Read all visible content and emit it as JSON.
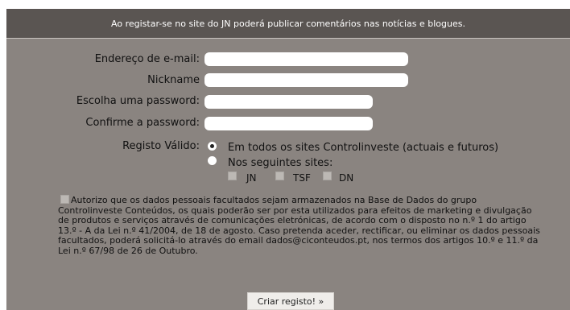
{
  "banner": {
    "text": "Ao registar-se no site do JN poderá publicar comentários nas notícias e blogues."
  },
  "form": {
    "email_label": "Endereço de e-mail:",
    "email_value": "",
    "nickname_label": "Nickname",
    "nickname_value": "",
    "password_label": "Escolha uma password:",
    "password_value": "",
    "confirm_label": "Confirme a password:",
    "confirm_value": "",
    "registo_label": "Registo Válido:",
    "option_all_label": "Em todos os sites Controlinveste (actuais e futuros)",
    "option_all_checked": true,
    "option_some_label": "Nos seguintes sites:",
    "option_some_checked": false,
    "sites": [
      {
        "label": "JN",
        "checked": false
      },
      {
        "label": "TSF",
        "checked": false
      },
      {
        "label": "DN",
        "checked": false
      }
    ],
    "consent_checked": false,
    "consent_text": "Autorizo que os dados pessoais facultados sejam armazenados na Base de Dados do grupo Controlinveste Conteúdos, os quais poderão ser por esta utilizados para efeitos de marketing e divulgação de produtos e serviços através de comunicações eletrónicas, de acordo com o disposto no n.º 1 do artigo 13.º - A da Lei n.º 41/2004, de 18 de agosto. Caso pretenda aceder, rectificar, ou eliminar os dados pessoais facultados, poderá solicitá-lo através do email dados@ciconteudos.pt, nos termos dos artigos 10.º e 11.º da Lei n.º 67/98 de 26 de Outubro.",
    "submit_label": "Criar registo! »"
  },
  "colors": {
    "panel": "#8a8480",
    "banner": "#5a5552",
    "button": "#efedea"
  }
}
